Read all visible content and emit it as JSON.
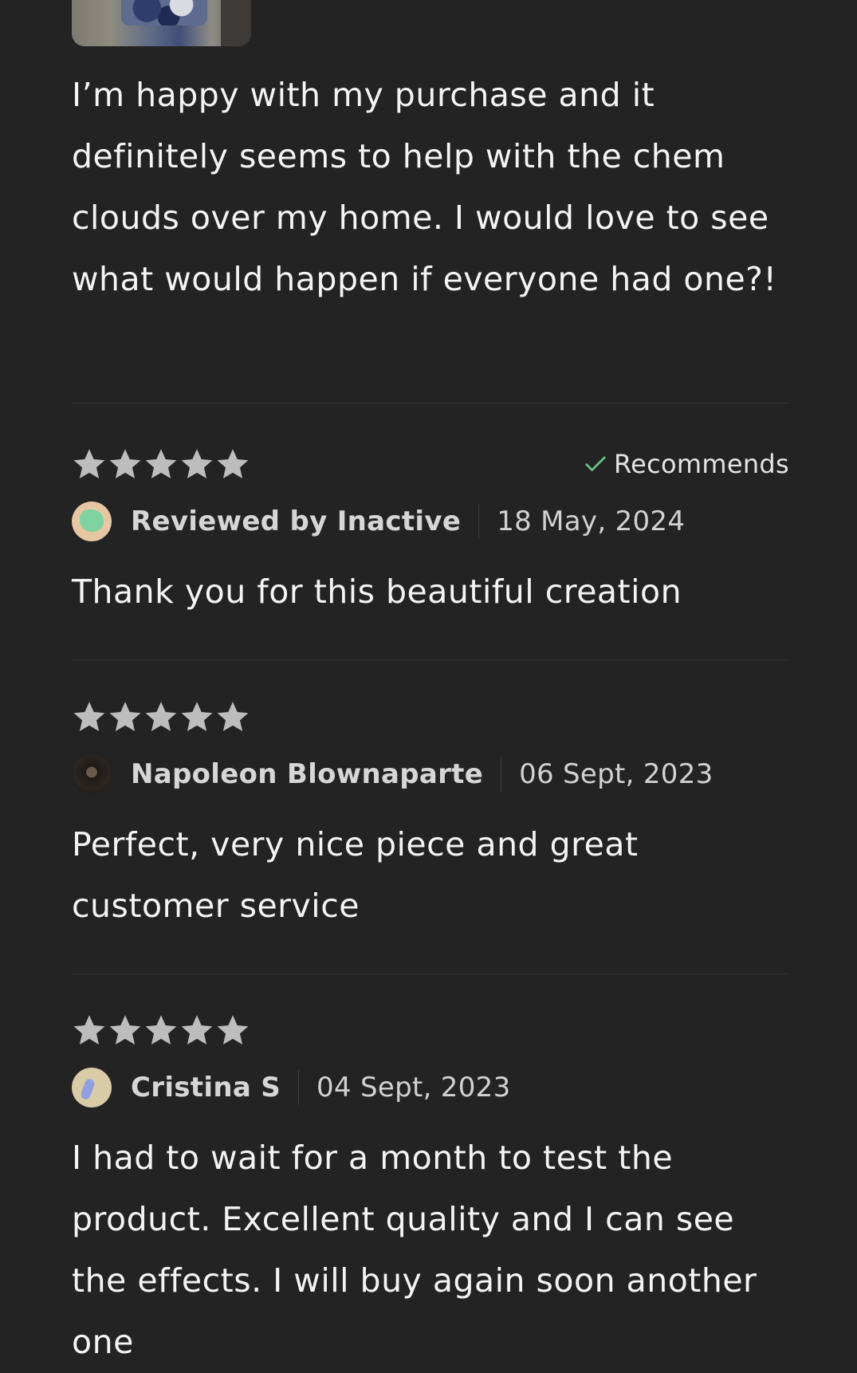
{
  "colors": {
    "background": "#232323",
    "star": "#bdbdbd",
    "check": "#6cc08b",
    "divider": "#333333"
  },
  "top_review": {
    "text": "I’m happy with my purchase and it definitely seems to help with the chem clouds over my home. I would love to see what would happen if everyone had one?!"
  },
  "reviews": [
    {
      "rating": 5,
      "recommends_label": "Recommends",
      "reviewer": "Reviewed by Inactive",
      "date": "18 May, 2024",
      "text": "Thank you for this beautiful creation"
    },
    {
      "rating": 5,
      "reviewer": "Napoleon Blownaparte",
      "date": "06 Sept, 2023",
      "text": "Perfect, very nice piece and great customer service"
    },
    {
      "rating": 5,
      "reviewer": "Cristina S",
      "date": "04 Sept, 2023",
      "text": "I had to wait for a month to test the product. Excellent quality and I can see the effects. I will buy again soon another one"
    }
  ]
}
